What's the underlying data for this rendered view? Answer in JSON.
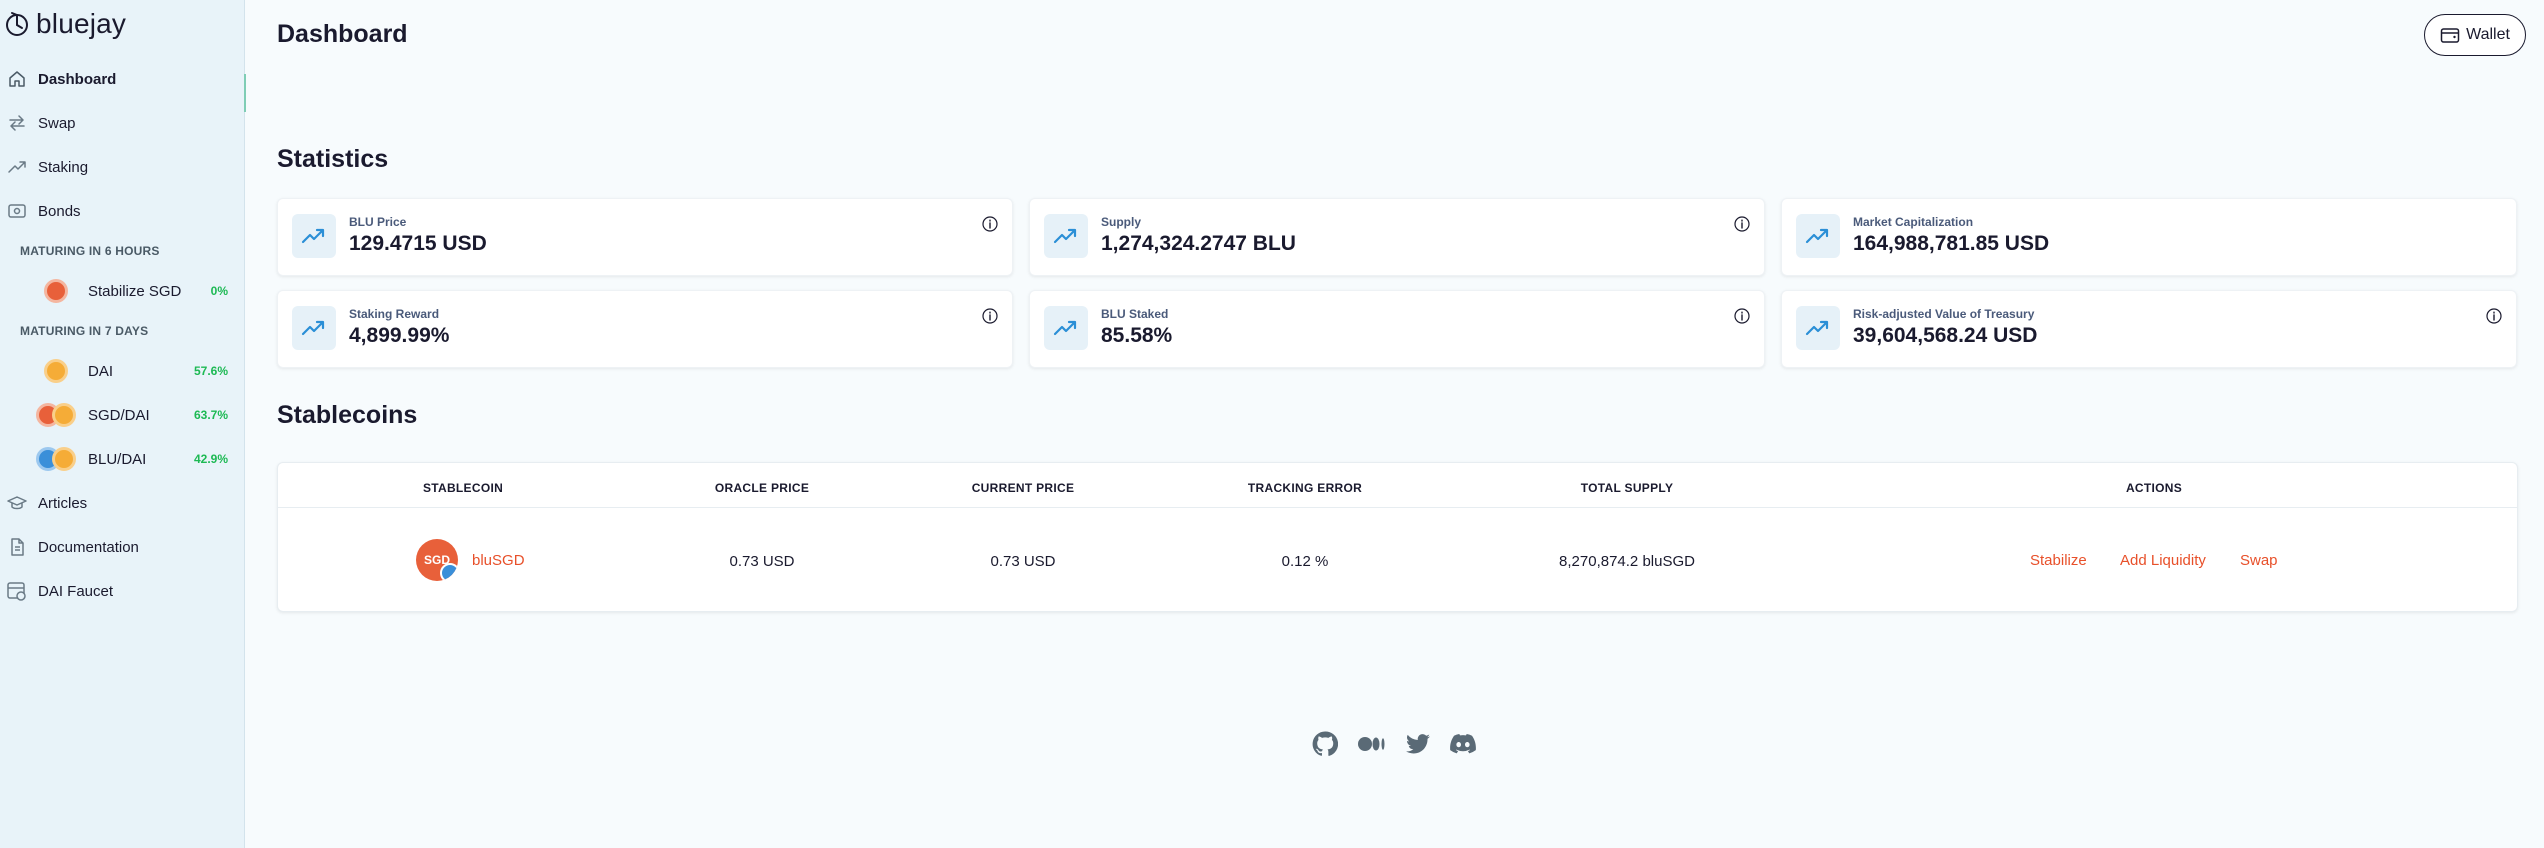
{
  "brand": {
    "name": "bluejay"
  },
  "sidebar": {
    "nav": [
      {
        "label": "Dashboard",
        "icon": "home-icon"
      },
      {
        "label": "Swap",
        "icon": "swap-icon"
      },
      {
        "label": "Staking",
        "icon": "trending-icon"
      },
      {
        "label": "Bonds",
        "icon": "bonds-icon"
      },
      {
        "label": "Articles",
        "icon": "hat-icon"
      },
      {
        "label": "Documentation",
        "icon": "document-icon"
      },
      {
        "label": "DAI Faucet",
        "icon": "faucet-icon"
      }
    ],
    "bond_sections": [
      {
        "heading": "MATURING IN 6 HOURS",
        "items": [
          {
            "name": "Stabilize SGD",
            "pct": "0%"
          }
        ]
      },
      {
        "heading": "MATURING IN 7 DAYS",
        "items": [
          {
            "name": "DAI",
            "pct": "57.6%"
          },
          {
            "name": "SGD/DAI",
            "pct": "63.7%"
          },
          {
            "name": "BLU/DAI",
            "pct": "42.9%"
          }
        ]
      }
    ]
  },
  "header": {
    "title": "Dashboard",
    "wallet_label": "Wallet"
  },
  "statistics": {
    "title": "Statistics",
    "cards": [
      {
        "label": "BLU Price",
        "value": "129.4715 USD",
        "info": true
      },
      {
        "label": "Supply",
        "value": "1,274,324.2747 BLU",
        "info": true
      },
      {
        "label": "Market Capitalization",
        "value": "164,988,781.85 USD",
        "info": false
      },
      {
        "label": "Staking Reward",
        "value": "4,899.99%",
        "info": true
      },
      {
        "label": "BLU Staked",
        "value": "85.58%",
        "info": true
      },
      {
        "label": "Risk-adjusted Value of Treasury",
        "value": "39,604,568.24 USD",
        "info": true
      }
    ]
  },
  "stablecoins": {
    "title": "Stablecoins",
    "columns": [
      "STABLECOIN",
      "ORACLE PRICE",
      "CURRENT PRICE",
      "TRACKING ERROR",
      "TOTAL SUPPLY",
      "ACTIONS"
    ],
    "rows": [
      {
        "coin_badge": "SGD",
        "name": "bluSGD",
        "oracle_price": "0.73 USD",
        "current_price": "0.73 USD",
        "tracking_error": "0.12 %",
        "total_supply": "8,270,874.2 bluSGD",
        "actions": [
          "Stabilize",
          "Add Liquidity",
          "Swap"
        ]
      }
    ]
  },
  "footer": {
    "icons": [
      "github-icon",
      "medium-icon",
      "twitter-icon",
      "discord-icon"
    ]
  },
  "colors": {
    "accent": "#e8502a",
    "positive": "#1db954",
    "sidebar_bg": "#e8f3f9",
    "page_bg": "#f7fbfd"
  }
}
